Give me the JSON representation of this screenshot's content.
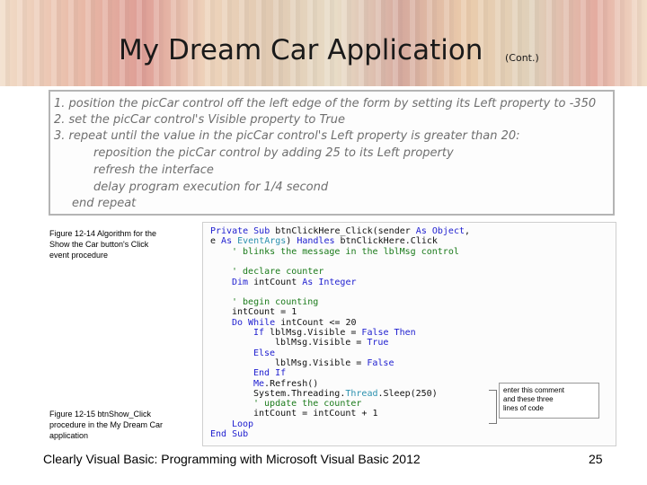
{
  "slide": {
    "title": "My Dream Car Application",
    "title_cont": "(Cont.)",
    "footer": "Clearly Visual Basic: Programming with Microsoft Visual Basic 2012",
    "page_number": "25"
  },
  "algorithm": {
    "lines": [
      "1.  position the picCar control off the left edge of the form by setting its Left property to -350",
      "2.  set the picCar control's Visible property to True",
      "3.  repeat until the value in the picCar control's Left property is greater than 20:",
      "reposition the picCar control by adding 25 to its Left property",
      "refresh the interface",
      "delay program execution for 1/4 second",
      "end repeat"
    ]
  },
  "captions": {
    "fig14": [
      "Figure 12-14 Algorithm for the",
      "Show the Car button's Click",
      "event procedure"
    ],
    "fig15": [
      "Figure 12-15 btnShow_Click",
      "procedure in the My Dream Car",
      "application"
    ]
  },
  "code": {
    "l0a": "Private Sub",
    "l0b": " btnClickHere_Click(sender ",
    "l0c": "As Object",
    "l1a": "e ",
    "l1b": "As ",
    "l1c": "EventArgs",
    "l1d": ") ",
    "l1e": "Handles",
    "l1f": " btnClickHere.Click",
    "l2": "' blinks the message in the lblMsg control",
    "l3": "' declare counter",
    "l4a": "Dim",
    "l4b": " intCount ",
    "l4c": "As Integer",
    "l5": "' begin counting",
    "l6": "intCount = 1",
    "l7a": "Do While",
    "l7b": " intCount <= 20",
    "l8a": "If",
    "l8b": " lblMsg.Visible = ",
    "l8c": "False Then",
    "l9a": "lblMsg.Visible = ",
    "l9b": "True",
    "l10": "Else",
    "l11a": "lblMsg.Visible = ",
    "l11b": "False",
    "l12": "End If",
    "l13": "Me.Refresh()",
    "l14a": "System.Threading.",
    "l14b": "Thread",
    "l14c": ".Sleep(250)",
    "l15": "' update the counter",
    "l16": "intCount = intCount + 1",
    "l17": "Loop",
    "l18": "End Sub"
  },
  "callout": {
    "lines": [
      "enter this comment",
      "and these three",
      "lines of code"
    ]
  }
}
